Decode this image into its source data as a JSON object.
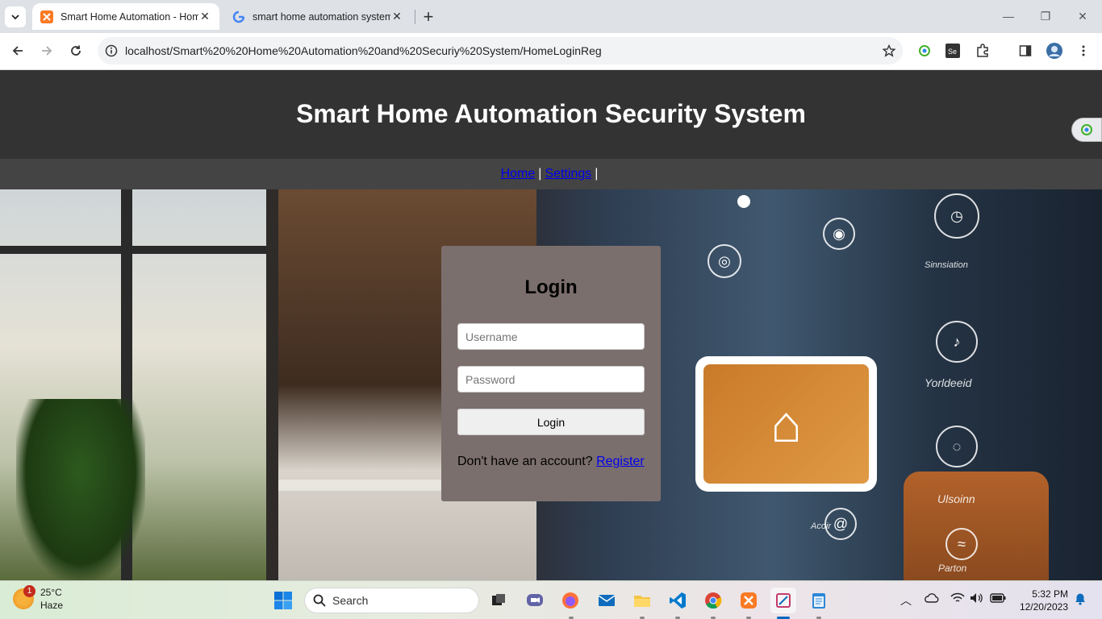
{
  "browser": {
    "tabs": [
      {
        "title": "Smart Home Automation - Home",
        "active": true,
        "favicon": "xampp-icon"
      },
      {
        "title": "smart home automation system",
        "active": false,
        "favicon": "google-icon"
      }
    ],
    "url": "localhost/Smart%20%20Home%20Automation%20and%20Securiy%20System/HomeLoginReg"
  },
  "site": {
    "title": "Smart Home Automation Security System",
    "nav": {
      "home": "Home",
      "settings": "Settings",
      "sep": "|"
    }
  },
  "hero": {
    "labels": [
      "Yorldeeid",
      "Ulsoinn",
      "Acoir",
      "Parton",
      "Sinnsiation"
    ]
  },
  "login": {
    "heading": "Login",
    "username_placeholder": "Username",
    "password_placeholder": "Password",
    "button": "Login",
    "register_prompt": "Don't have an account?",
    "register_link": "Register"
  },
  "taskbar": {
    "weather": {
      "temp": "25°C",
      "condition": "Haze",
      "badge": "1"
    },
    "search_label": "Search",
    "time": "5:32 PM",
    "date": "12/20/2023"
  },
  "colors": {
    "header_bg": "#333333",
    "nav_bg": "#444444",
    "login_bg": "#7b6f6d",
    "link": "#0000ee"
  }
}
